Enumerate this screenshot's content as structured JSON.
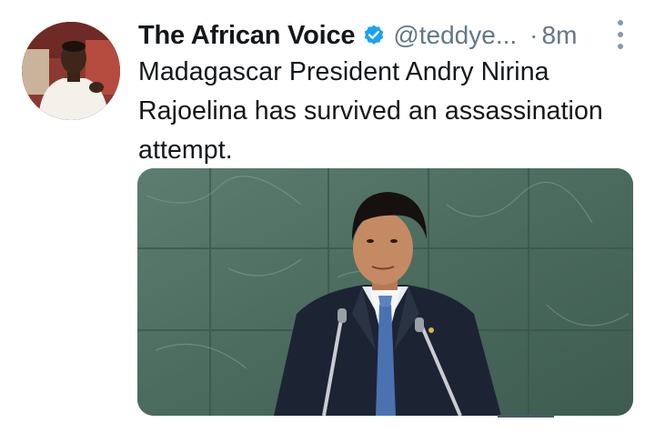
{
  "tweet": {
    "author": {
      "display_name": "The African Voice",
      "handle": "@teddye...",
      "verified": true,
      "avatar_icon": "avatar-photo"
    },
    "separator": "·",
    "time": "8m",
    "text": "Madagascar President Andry Nirina Rajoelina has survived an assassination attempt.",
    "media": {
      "type": "photo",
      "icon": "photo-president-speaking"
    }
  },
  "colors": {
    "text_primary": "#14171a",
    "text_secondary": "#657786",
    "verified_blue": "#1da1f2",
    "background": "#ffffff"
  }
}
